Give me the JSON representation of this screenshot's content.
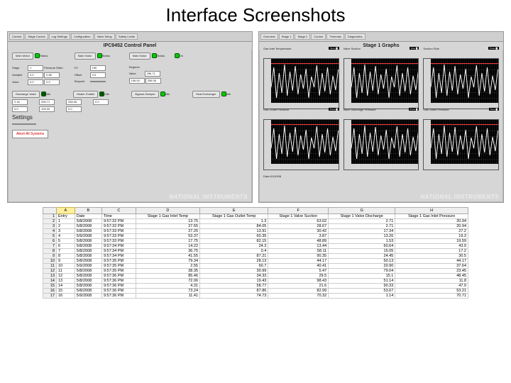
{
  "slide": {
    "title": "Interface Screenshots"
  },
  "left_panel": {
    "title": "IPC9452 Control Panel",
    "tabs": [
      "Current",
      "Stage Curves",
      "Log Settings",
      "Configuration",
      "Valve Setup",
      "Safety Limits"
    ],
    "motor_buttons": [
      "Main Motor",
      "Main Motor",
      "Main Motor"
    ],
    "status_labels": [
      "Status",
      "Status",
      "Status",
      "On"
    ],
    "section_labels": {
      "stage": "Stage",
      "fc": "FC",
      "pressure_ratio": "Pressure Ratio",
      "variable": "Variable",
      "offset": "Offset",
      "degrees": "Degrees",
      "valve": "Valve",
      "setpoint": "Setpoint",
      "value": "Value"
    },
    "fields": {
      "stage": "1",
      "fc": "180",
      "pr": "0.86",
      "var": "0.0",
      "off": "0.0",
      "deg": "",
      "v1": "0.0",
      "v2": "0.0",
      "v3": "",
      "sp1": "256.71",
      "sp2": "106.00",
      "sp3": "256.06",
      "sp4": "2.16",
      "sp5": "0.0",
      "sp6": "0.0"
    },
    "lower_buttons": [
      "Discharge Valve",
      "Heater Enable",
      "Bypass Damper",
      "Heat Exchanger"
    ],
    "lower_labels": [
      "Idle",
      "Idle",
      "Idle",
      "Idle"
    ],
    "settings_title": "Settings",
    "abort": "Abort All Systems"
  },
  "right_panel": {
    "title": "Stage 1 Graphs",
    "tabs": [
      "Overview",
      "Stage 1",
      "Stage 2",
      "Control",
      "Thermals",
      "Diagnostics"
    ],
    "footer": "Data 61/30/08",
    "charts": [
      {
        "title": "Gas Inlet Temperature",
        "legend": "Temp"
      },
      {
        "title": "Valve Suction",
        "legend": "Flow"
      },
      {
        "title": "Suction Side",
        "legend": "Press"
      },
      {
        "title": "Gas Outlet Pressure",
        "legend": "Press"
      },
      {
        "title": "Valve Discharge Pressure",
        "legend": "Press"
      },
      {
        "title": "Gas Outlet Pressure",
        "legend": "Temp"
      }
    ]
  },
  "spreadsheet": {
    "active_col": "A",
    "cols": [
      "A",
      "B",
      "C",
      "D",
      "E",
      "F",
      "G",
      "H"
    ],
    "headers": [
      "",
      "Date",
      "Time",
      "Stage 1 Gas Inlet Temp",
      "Stage 1 Gas Outlet Temp",
      "Stage 1 Valve Suction",
      "Stage 1 Valve Discharge",
      "Stage 1 Gas Inlet Pressure"
    ],
    "first_cell": "Entry",
    "rows": [
      [
        "1",
        "5/8/2008",
        "9:57:32 PM",
        "13.75",
        "1.3",
        "63.02",
        "2.71",
        "20.94"
      ],
      [
        "2",
        "5/8/2008",
        "9:57:32 PM",
        "27.55",
        "84.05",
        "28.67",
        "2.71",
        "20.94"
      ],
      [
        "3",
        "5/8/2008",
        "9:57:33 PM",
        "27.25",
        "13.91",
        "30.42",
        "17.34",
        "27.2"
      ],
      [
        "4",
        "5/9/2008",
        "9:57:33 PM",
        "53.37",
        "60.35",
        "3.87",
        "13.26",
        "19.3"
      ],
      [
        "5",
        "5/8/2008",
        "9:57:33 PM",
        "17.75",
        "82.15",
        "48.89",
        "1.53",
        "19.59"
      ],
      [
        "6",
        "5/8/2008",
        "9:57:34 PM",
        "14.22",
        "24.3",
        "13.44",
        "60.64",
        "43.9"
      ],
      [
        "7",
        "5/8/2008",
        "9:57:34 PM",
        "36.75",
        "0.4",
        "58.11",
        "15.05",
        "17.2"
      ],
      [
        "8",
        "5/8/2008",
        "9:57:34 PM",
        "41.55",
        "87.21",
        "90.35",
        "24.45",
        "30.5"
      ],
      [
        "9",
        "5/8/2008",
        "9:57:35 PM",
        "79.34",
        "28.13",
        "44.17",
        "50.13",
        "44.17"
      ],
      [
        "10",
        "5/9/2008",
        "9:57:35 PM",
        "2.55",
        "60.7",
        "40.41",
        "20.90",
        "37.64"
      ],
      [
        "11",
        "5/8/2008",
        "9:57:35 PM",
        "38.35",
        "30.99",
        "5.47",
        "79.04",
        "23.45"
      ],
      [
        "12",
        "5/8/2008",
        "9:57:36 PM",
        "85.46",
        "34.33",
        "29.5",
        "15.1",
        "48.45"
      ],
      [
        "13",
        "5/8/2008",
        "9:57:36 PM",
        "72.06",
        "19.43",
        "98.43",
        "51.14",
        "11.8"
      ],
      [
        "14",
        "5/8/2008",
        "9:57:36 PM",
        "4.31",
        "58.77",
        "21.6",
        "90.33",
        "47.9"
      ],
      [
        "15",
        "5/8/2008",
        "9:57:36 PM",
        "73.24",
        "87.86",
        "82.99",
        "53.67",
        "53.21"
      ],
      [
        "16",
        "5/9/2008",
        "9:57:36 PM",
        "11.41",
        "74.73",
        "70.32",
        "1.14",
        "70.71"
      ]
    ]
  },
  "brand": "NATIONAL INSTRUMENTS"
}
